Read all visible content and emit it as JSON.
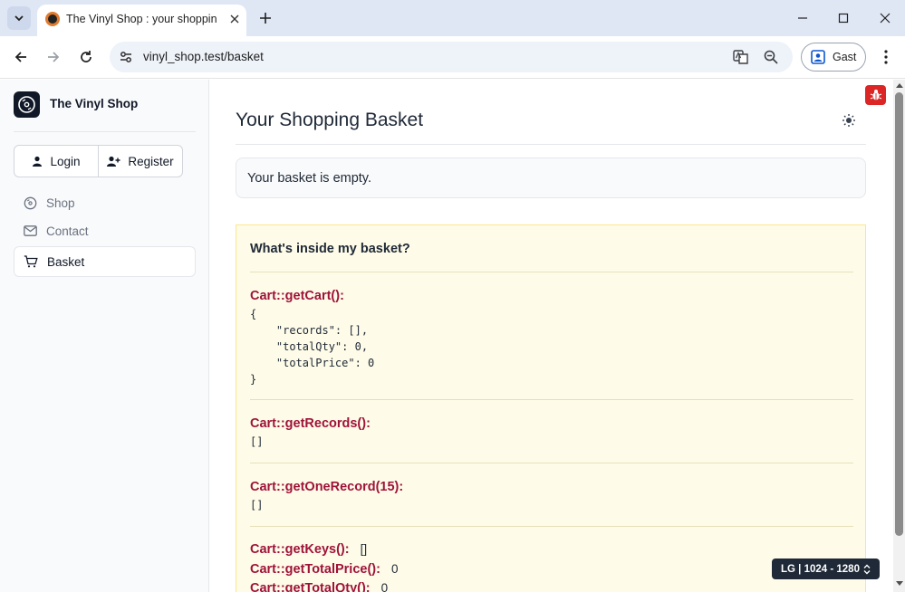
{
  "browser": {
    "tab_title": "The Vinyl Shop : your shopping basket",
    "url": "vinyl_shop.test/basket",
    "profile_label": "Gast"
  },
  "sidebar": {
    "brand_name": "The Vinyl Shop",
    "login_label": "Login",
    "register_label": "Register",
    "items": [
      {
        "label": "Shop",
        "icon": "vinyl-record-icon",
        "active": false
      },
      {
        "label": "Contact",
        "icon": "envelope-icon",
        "active": false
      },
      {
        "label": "Basket",
        "icon": "cart-icon",
        "active": true
      }
    ]
  },
  "main": {
    "title": "Your Shopping Basket",
    "empty_message": "Your basket is empty.",
    "debug": {
      "heading": "What's inside my basket?",
      "get_cart_label": "Cart::getCart():",
      "get_cart_output": "{\n    \"records\": [],\n    \"totalQty\": 0,\n    \"totalPrice\": 0\n}",
      "get_records_label": "Cart::getRecords():",
      "get_records_output": "[]",
      "get_one_record_label": "Cart::getOneRecord(15):",
      "get_one_record_output": "[]",
      "get_keys_label": "Cart::getKeys():",
      "get_keys_output": "[]",
      "get_total_price_label": "Cart::getTotalPrice():",
      "get_total_price_output": "0",
      "get_total_qty_label": "Cart::getTotalQty():",
      "get_total_qty_output": "0"
    }
  },
  "breakpoint_badge": "LG | 1024 - 1280",
  "colors": {
    "accent_red": "#9f1239",
    "debug_bg": "#fefce8"
  }
}
